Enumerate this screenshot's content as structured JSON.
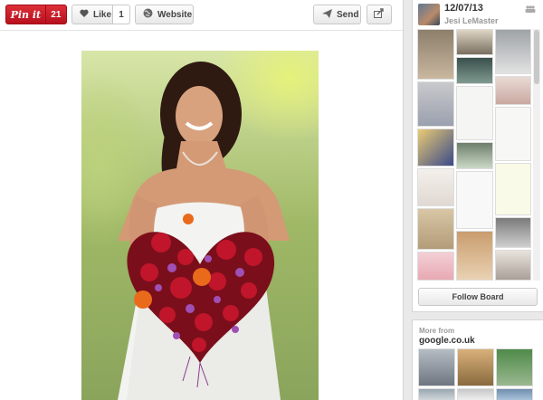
{
  "toolbar": {
    "pin_label": "Pin it",
    "pin_count": "21",
    "like_label": "Like",
    "like_count": "1",
    "website_label": "Website",
    "send_label": "Send",
    "icons": {
      "like": "heart-icon",
      "website": "globe-icon",
      "send": "paper-plane-icon",
      "share": "share-icon"
    }
  },
  "pin": {
    "image": "bride-with-red-heart-bouquet-photo"
  },
  "board": {
    "date": "12/07/13",
    "user": "Jesi LeMaster",
    "avatar": "user-avatar",
    "group_icon": "group-board-icon",
    "follow_label": "Follow Board"
  },
  "more_from": {
    "label": "More from",
    "domain": "google.co.uk"
  },
  "colors": {
    "pin_red": "#cb2027",
    "text_dark": "#333333",
    "text_muted": "#999999",
    "bouquet_red": "#c0152a",
    "bouquet_orange": "#ea6a1c",
    "bouquet_purple": "#a04fb5"
  }
}
